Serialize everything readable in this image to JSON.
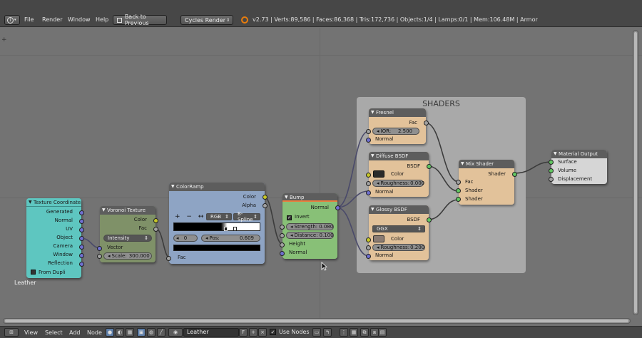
{
  "header": {
    "editor_type_icon": "info-icon",
    "menus": [
      "File",
      "Render",
      "Window",
      "Help"
    ],
    "back_button": "Back to Previous",
    "render_engine": "Cycles Render",
    "stats": "v2.73 | Verts:89,586 | Faces:86,368 | Tris:172,736 | Objects:1/4 | Lamps:0/1 | Mem:106.48M | Armor"
  },
  "editor": {
    "view_label": "Leather",
    "frame": {
      "label": "SHADERS",
      "color": "#a9a9a9"
    },
    "nodes": {
      "texture_coordinate": {
        "title": "Texture Coordinate",
        "outputs": [
          "Generated",
          "Normal",
          "UV",
          "Object",
          "Camera",
          "Window",
          "Reflection"
        ],
        "from_dupli": "From Dupli",
        "color": "#5ec6c0"
      },
      "voronoi": {
        "title": "Voronoi Texture",
        "outputs": [
          "Color",
          "Fac"
        ],
        "coloring": "Intensity",
        "vector_label": "Vector",
        "scale_label": "Scale:",
        "scale_value": "300.000",
        "color": "#7f9168"
      },
      "colorramp": {
        "title": "ColorRamp",
        "outputs": [
          "Color",
          "Alpha"
        ],
        "color_mode": "RGB",
        "interpolation": "B-Spline",
        "stop_index": "0",
        "pos_label": "Pos:",
        "pos_value": "0.609",
        "input": "Fac",
        "color": "#8ea4c4"
      },
      "bump": {
        "title": "Bump",
        "output": "Normal",
        "invert": "Invert",
        "strength_label": "Strength:",
        "strength_value": "0.080",
        "distance_label": "Distance:",
        "distance_value": "0.100",
        "inputs": [
          "Height",
          "Normal"
        ],
        "color": "#88c077"
      },
      "fresnel": {
        "title": "Fresnel",
        "output": "Fac",
        "ior_label": "IOR:",
        "ior_value": "2.500",
        "input": "Normal",
        "color": "#e2c29a"
      },
      "diffuse": {
        "title": "Diffuse BSDF",
        "output": "BSDF",
        "color_label": "Color",
        "roughness_label": "Roughness:",
        "roughness_value": "0.000",
        "input": "Normal",
        "swatch": "#2a2a2a",
        "color": "#e2c29a"
      },
      "glossy": {
        "title": "Glossy BSDF",
        "output": "BSDF",
        "distribution": "GGX",
        "color_label": "Color",
        "roughness_label": "Roughness:",
        "roughness_value": "0.200",
        "input": "Normal",
        "swatch": "#8a7b72",
        "color": "#e2c29a"
      },
      "mix": {
        "title": "Mix Shader",
        "output": "Shader",
        "inputs": [
          "Fac",
          "Shader",
          "Shader"
        ],
        "color": "#e2c29a"
      },
      "output": {
        "title": "Material Output",
        "inputs": [
          "Surface",
          "Volume",
          "Displacement"
        ],
        "color": "#d6d6d6"
      }
    }
  },
  "bottombar": {
    "menus": [
      "View",
      "Select",
      "Add",
      "Node"
    ],
    "material_name": "Leather",
    "fake_user": "F",
    "use_nodes_label": "Use Nodes"
  }
}
